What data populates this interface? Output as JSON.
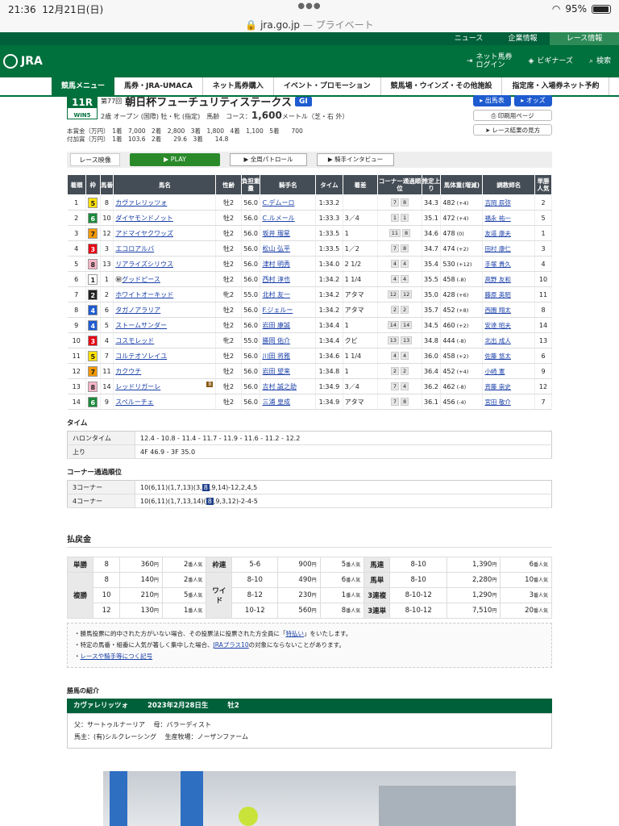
{
  "status": {
    "time": "21:36",
    "date": "12月21日(日)",
    "battery": "95%"
  },
  "url": {
    "domain": "jra.go.jp",
    "suffix": "— プライベート"
  },
  "topnav": [
    "ニュース",
    "企業情報",
    "レース情報"
  ],
  "header": {
    "logo": "JRA",
    "links": [
      "ネット馬券\nログイン",
      "ビギナーズ",
      "検索"
    ]
  },
  "menu": [
    "競馬メニュー",
    "馬券・JRA-UMACA",
    "ネット馬券購入",
    "イベント・プロモーション",
    "競馬場・ウインズ・その他施設",
    "指定席・入場券ネット予約"
  ],
  "race": {
    "num": "11R",
    "win5": "WIN5",
    "edition": "第77回",
    "name": "朝日杯フューチュリティステークス",
    "grade": "GI",
    "cond": "2歳 オープン (国際) 牡・牝 (指定)　馬齢",
    "course_label": "コース：",
    "distance": "1,600",
    "course_unit": "メートル（芝・右 外）",
    "prize1": "本賞金（万円）　1着　7,000　2着　2,800　3着　1,800　4着　1,100　5着　　700",
    "prize2": "付加賞（万円）　1着　103.6　2着　　29.6　3着　　14.8"
  },
  "buttons": {
    "entries": "出馬表",
    "odds": "オッズ",
    "print": "印刷用ページ",
    "howto": "レース結果の見方"
  },
  "video": {
    "label": "レース映像",
    "play": "PLAY",
    "patrol": "全周パトロール",
    "interview": "騎手インタビュー"
  },
  "columns": [
    "着順",
    "枠",
    "馬番",
    "馬名",
    "性齢",
    "負担重量",
    "騎手名",
    "タイム",
    "着差",
    "コーナー通過順位",
    "推定上り",
    "馬体重(増減)",
    "調教師名",
    "単勝人気"
  ],
  "results": [
    {
      "pos": "1",
      "frame": "5",
      "num": "8",
      "horse": "カヴァレリッツォ",
      "sex": "牡2",
      "wt": "56.0",
      "jockey": "C.デムーロ",
      "time": "1:33.2",
      "margin": "",
      "corner": [
        "7",
        "8"
      ],
      "last": "34.3",
      "bw": "482",
      "bwd": "(+4)",
      "trainer": "吉岡 辰弥",
      "pop": "2"
    },
    {
      "pos": "2",
      "frame": "6",
      "num": "10",
      "horse": "ダイヤモンドノット",
      "sex": "牡2",
      "wt": "56.0",
      "jockey": "C.ルメール",
      "time": "1:33.3",
      "margin": "3／4",
      "corner": [
        "1",
        "1"
      ],
      "last": "35.1",
      "bw": "472",
      "bwd": "(+4)",
      "trainer": "福永 祐一",
      "pop": "5"
    },
    {
      "pos": "3",
      "frame": "7",
      "num": "12",
      "horse": "アドマイヤクワッズ",
      "sex": "牡2",
      "wt": "56.0",
      "jockey": "坂井 瑠星",
      "time": "1:33.5",
      "margin": "1",
      "corner": [
        "11",
        "8"
      ],
      "last": "34.6",
      "bw": "478",
      "bwd": "(0)",
      "trainer": "友道 康夫",
      "pop": "1"
    },
    {
      "pos": "4",
      "frame": "3",
      "num": "3",
      "horse": "エコロアルバ",
      "sex": "牡2",
      "wt": "56.0",
      "jockey": "松山 弘平",
      "time": "1:33.5",
      "margin": "1／2",
      "corner": [
        "7",
        "8"
      ],
      "last": "34.7",
      "bw": "474",
      "bwd": "(+2)",
      "trainer": "田村 康仁",
      "pop": "3"
    },
    {
      "pos": "5",
      "frame": "8",
      "num": "13",
      "horse": "リアライズシリウス",
      "sex": "牡2",
      "wt": "56.0",
      "jockey": "津村 明秀",
      "time": "1:34.0",
      "margin": "2 1/2",
      "corner": [
        "4",
        "4"
      ],
      "last": "35.4",
      "bw": "530",
      "bwd": "(+12)",
      "trainer": "手塚 貴久",
      "pop": "4"
    },
    {
      "pos": "6",
      "frame": "1",
      "num": "1",
      "horse": "グッドピース",
      "sex": "牡2",
      "wt": "56.0",
      "jockey": "西村 淳也",
      "time": "1:34.2",
      "margin": "1 1/4",
      "corner": [
        "4",
        "4"
      ],
      "last": "35.5",
      "bw": "458",
      "bwd": "(-8)",
      "trainer": "高野 友和",
      "pop": "10",
      "mark": "㊙"
    },
    {
      "pos": "7",
      "frame": "2",
      "num": "2",
      "horse": "ホワイトオーキッド",
      "sex": "牝2",
      "wt": "55.0",
      "jockey": "北村 友一",
      "time": "1:34.2",
      "margin": "アタマ",
      "corner": [
        "12",
        "12"
      ],
      "last": "35.0",
      "bw": "428",
      "bwd": "(+6)",
      "trainer": "藤原 英昭",
      "pop": "11"
    },
    {
      "pos": "8",
      "frame": "4",
      "num": "6",
      "horse": "タガノアラリア",
      "sex": "牡2",
      "wt": "56.0",
      "jockey": "F.ジェルー",
      "time": "1:34.2",
      "margin": "アタマ",
      "corner": [
        "2",
        "2"
      ],
      "last": "35.7",
      "bw": "452",
      "bwd": "(+8)",
      "trainer": "西園 翔太",
      "pop": "8"
    },
    {
      "pos": "9",
      "frame": "4",
      "num": "5",
      "horse": "ストームサンダー",
      "sex": "牡2",
      "wt": "56.0",
      "jockey": "岩田 康誠",
      "time": "1:34.4",
      "margin": "1",
      "corner": [
        "14",
        "14"
      ],
      "last": "34.5",
      "bw": "460",
      "bwd": "(+2)",
      "trainer": "安達 昭夫",
      "pop": "14"
    },
    {
      "pos": "10",
      "frame": "3",
      "num": "4",
      "horse": "コスモレッド",
      "sex": "牝2",
      "wt": "55.0",
      "jockey": "勝岡 佑介",
      "time": "1:34.4",
      "margin": "クビ",
      "corner": [
        "13",
        "13"
      ],
      "last": "34.8",
      "bw": "444",
      "bwd": "(-8)",
      "trainer": "北出 成人",
      "pop": "13"
    },
    {
      "pos": "11",
      "frame": "5",
      "num": "7",
      "horse": "コルテオソレイユ",
      "sex": "牡2",
      "wt": "56.0",
      "jockey": "川田 将雅",
      "time": "1:34.6",
      "margin": "1 1/4",
      "corner": [
        "4",
        "4"
      ],
      "last": "36.0",
      "bw": "458",
      "bwd": "(+2)",
      "trainer": "佐藤 悠太",
      "pop": "6"
    },
    {
      "pos": "12",
      "frame": "7",
      "num": "11",
      "horse": "カクウチ",
      "sex": "牡2",
      "wt": "56.0",
      "jockey": "岩田 望来",
      "time": "1:34.8",
      "margin": "1",
      "corner": [
        "2",
        "2"
      ],
      "last": "36.4",
      "bw": "452",
      "bwd": "(+4)",
      "trainer": "小崎 憲",
      "pop": "9"
    },
    {
      "pos": "13",
      "frame": "8",
      "num": "14",
      "horse": "レッドリガーレ",
      "sex": "牡2",
      "wt": "56.0",
      "jockey": "吉村 誠之助",
      "time": "1:34.9",
      "margin": "3／4",
      "corner": [
        "7",
        "4"
      ],
      "last": "36.2",
      "bw": "462",
      "bwd": "(-8)",
      "trainer": "斉藤 崇史",
      "pop": "12",
      "blinker": "B"
    },
    {
      "pos": "14",
      "frame": "6",
      "num": "9",
      "horse": "スペルーチェ",
      "sex": "牡2",
      "wt": "56.0",
      "jockey": "三浦 皇成",
      "time": "1:34.9",
      "margin": "アタマ",
      "corner": [
        "7",
        "8"
      ],
      "last": "36.1",
      "bw": "456",
      "bwd": "(-4)",
      "trainer": "宮田 敬介",
      "pop": "7"
    }
  ],
  "frameColors": {
    "1": [
      "#ffffff",
      "#222"
    ],
    "2": [
      "#222222",
      "#fff"
    ],
    "3": [
      "#e60012",
      "#fff"
    ],
    "4": [
      "#1e5bd0",
      "#fff"
    ],
    "5": [
      "#ffe100",
      "#222"
    ],
    "6": [
      "#1a8a3a",
      "#fff"
    ],
    "7": [
      "#f39800",
      "#222"
    ],
    "8": [
      "#f7b6c8",
      "#222"
    ]
  },
  "timeSec": {
    "title": "タイム",
    "rows": [
      {
        "k": "ハロンタイム",
        "v": "12.4 - 10.8 - 11.4 - 11.7 - 11.9 - 11.6 - 11.2 - 12.2"
      },
      {
        "k": "上り",
        "v": "4F 46.9 - 3F 35.0"
      }
    ]
  },
  "cornerSec": {
    "title": "コーナー通過順位",
    "rows": [
      {
        "k": "3コーナー",
        "pre": "10(6,11)(1,7,13)(3,",
        "hl": "8",
        "post": ",9,14)-12,2,4,5"
      },
      {
        "k": "4コーナー",
        "pre": "10(6,11)(1,7,13,14)(",
        "hl": "8",
        "post": ",9,3,12)-2-4-5"
      }
    ]
  },
  "payout": {
    "title": "払戻金",
    "pop_unit": "番人気",
    "yen": "円",
    "tan": {
      "label": "単勝",
      "num": "8",
      "amt": "360",
      "pop": "2"
    },
    "fuku": {
      "label": "複勝",
      "rows": [
        {
          "num": "8",
          "amt": "140",
          "pop": "2"
        },
        {
          "num": "10",
          "amt": "210",
          "pop": "5"
        },
        {
          "num": "12",
          "amt": "130",
          "pop": "1"
        }
      ]
    },
    "waku": {
      "label": "枠連",
      "num": "5-6",
      "amt": "900",
      "pop": "5"
    },
    "wide": {
      "label": "ワイド",
      "rows": [
        {
          "num": "8-10",
          "amt": "490",
          "pop": "6"
        },
        {
          "num": "8-12",
          "amt": "230",
          "pop": "1"
        },
        {
          "num": "10-12",
          "amt": "560",
          "pop": "8"
        }
      ]
    },
    "right": [
      {
        "label": "馬連",
        "num": "8-10",
        "amt": "1,390",
        "pop": "6"
      },
      {
        "label": "馬単",
        "num": "8-10",
        "amt": "2,280",
        "pop": "10"
      },
      {
        "label": "3連複",
        "num": "8-10-12",
        "amt": "1,290",
        "pop": "3"
      },
      {
        "label": "3連単",
        "num": "8-10-12",
        "amt": "7,510",
        "pop": "20"
      }
    ]
  },
  "notes": {
    "l1a": "勝馬投票に的中された方がいない場合、その投票法に投票された方全員に「",
    "l1link": "特払い",
    "l1b": "」をいたします。",
    "l2a": "特定の馬番・組番に人気が著しく集中した場合、",
    "l2link": "JRAプラス10",
    "l2b": "の対象にならないことがあります。",
    "l3link": "レースや騎手等につく記号"
  },
  "winner": {
    "title": "勝馬の紹介",
    "name": "カヴァレリッツォ",
    "born": "2023年2月28日生",
    "sex": "牡2",
    "line1": "父：サートゥルナーリア　 母：バラーディスト",
    "line2": "馬主：(有)シルクレーシング　 生産牧場：ノーザンファーム"
  }
}
